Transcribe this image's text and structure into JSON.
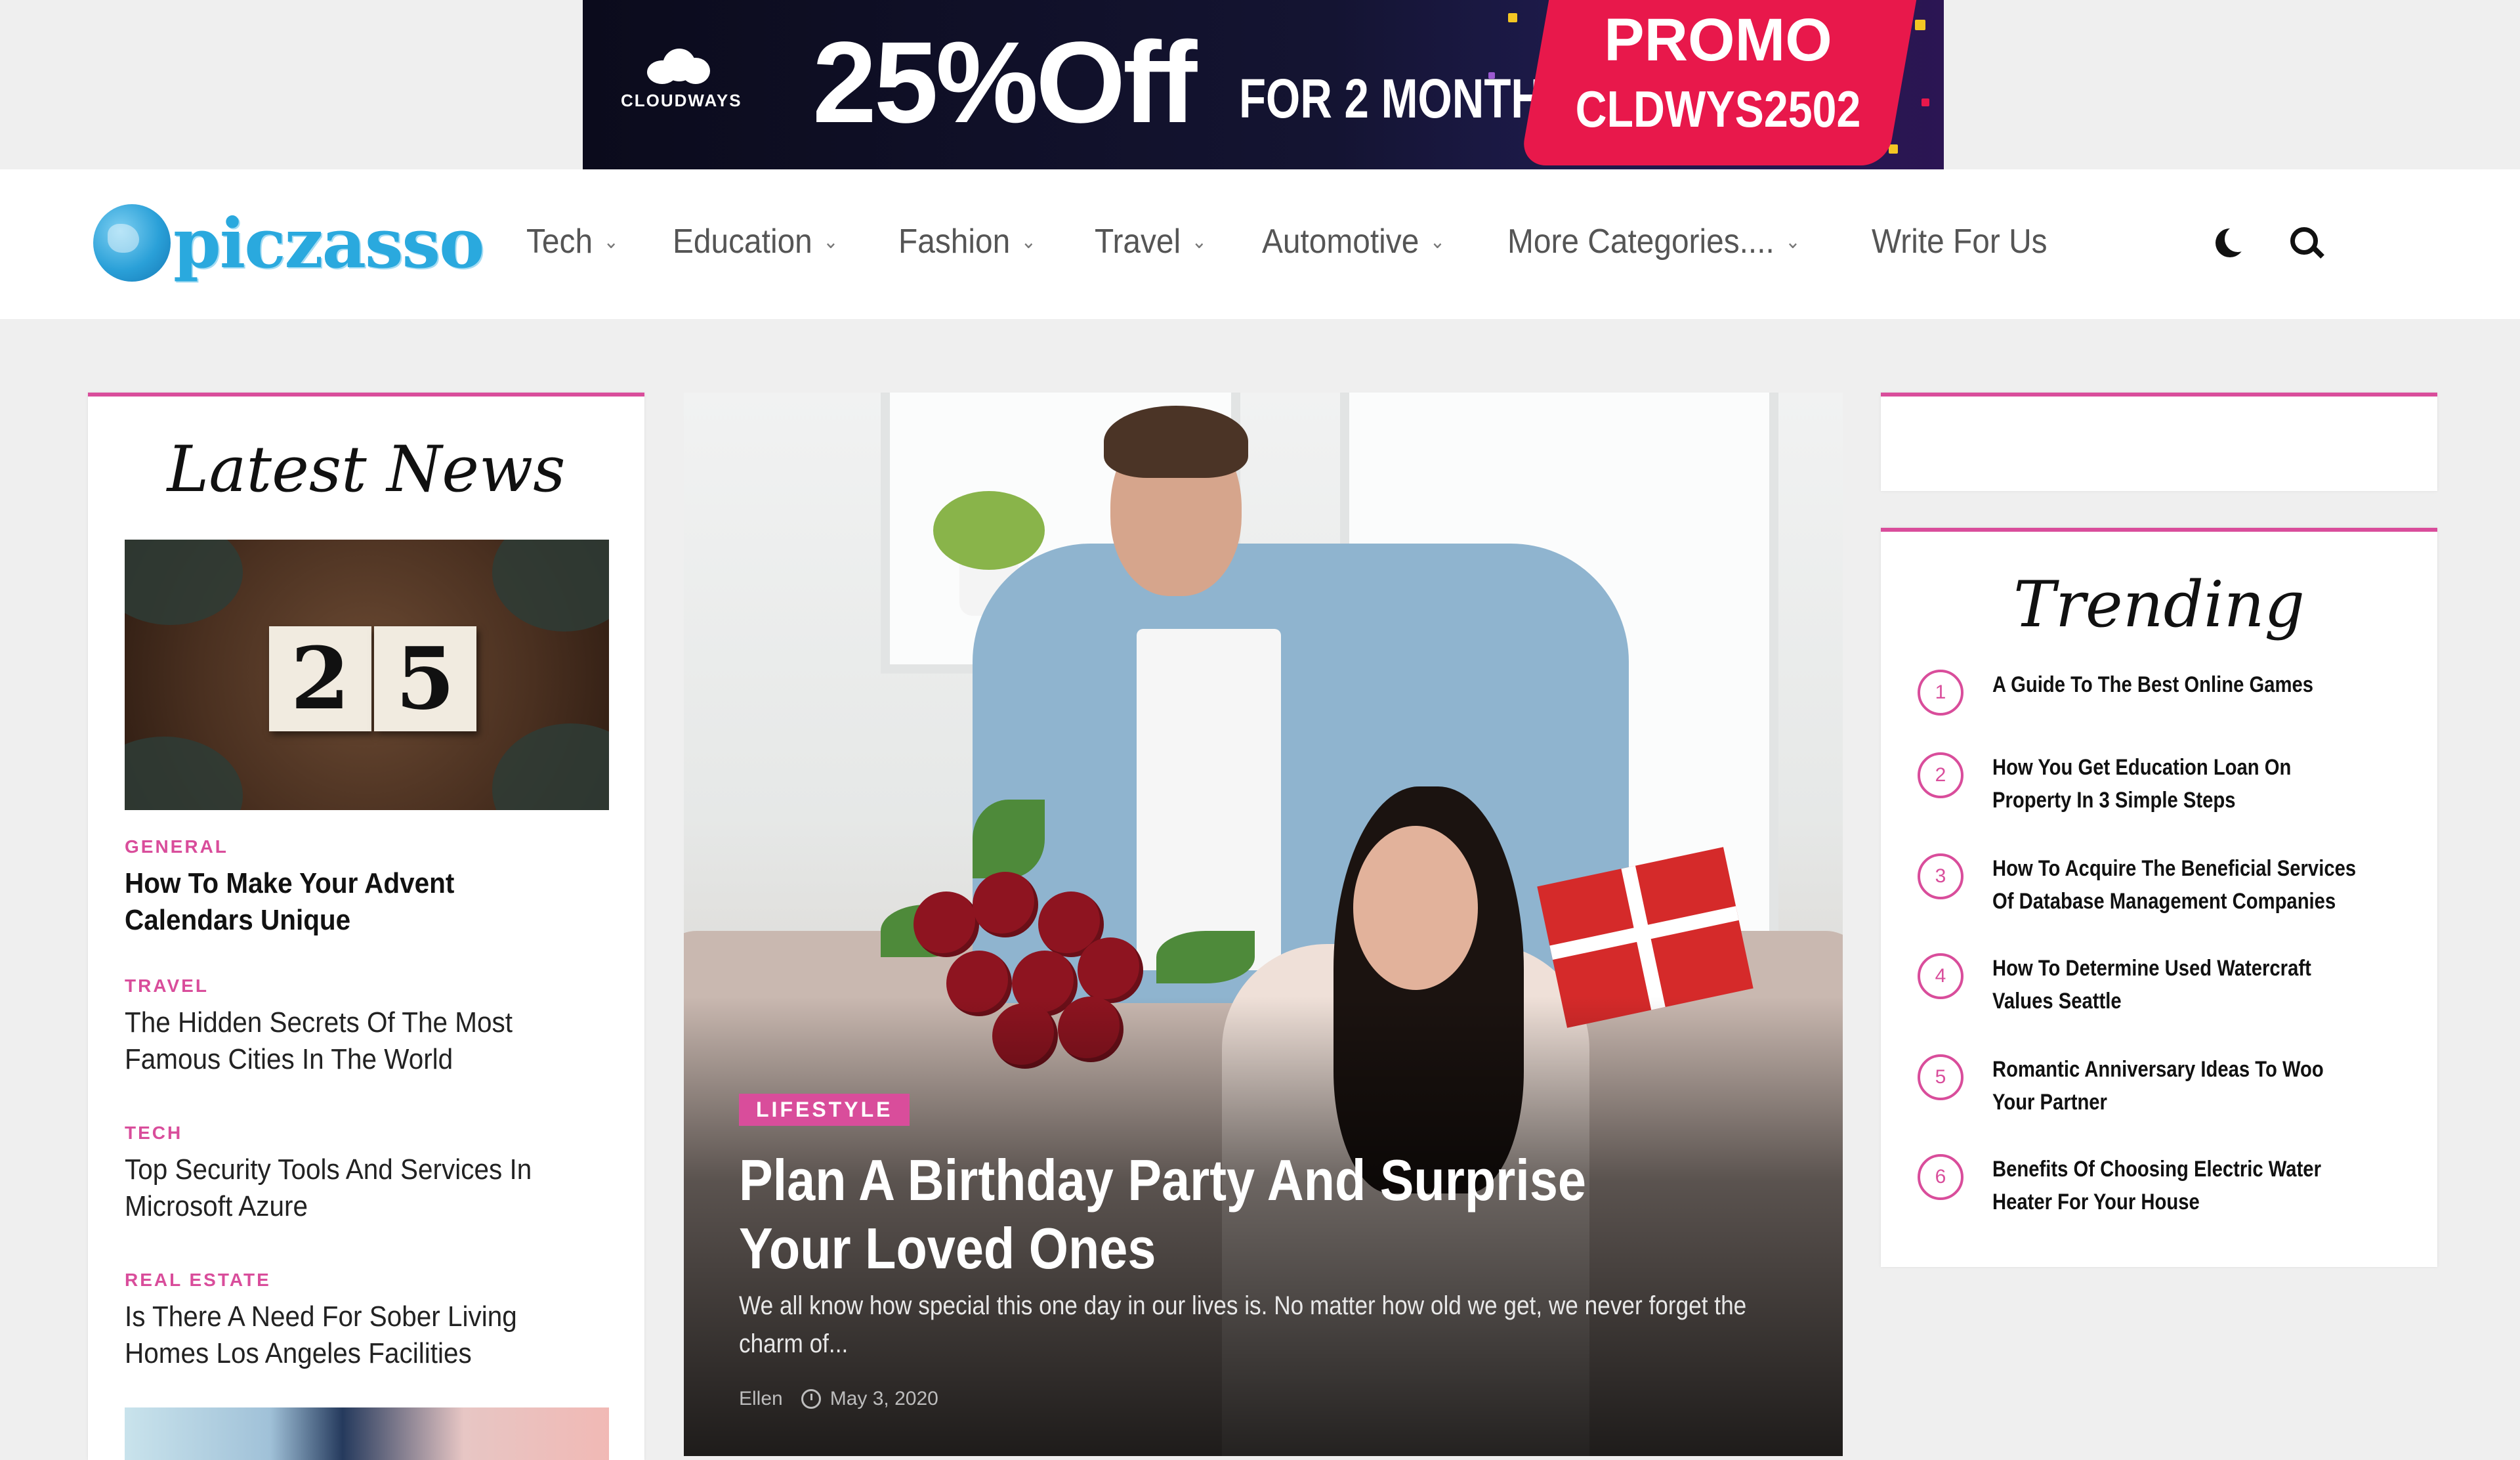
{
  "ad": {
    "brand": "CLOUDWAYS",
    "headline": "25%Off",
    "subline": "FOR 2 MONTHS",
    "promo_label": "PROMO",
    "promo_code": "CLDWYS2502"
  },
  "header": {
    "logo_text": "piczasso",
    "nav": [
      {
        "label": "Tech"
      },
      {
        "label": "Education"
      },
      {
        "label": "Fashion"
      },
      {
        "label": "Travel"
      },
      {
        "label": "Automotive"
      },
      {
        "label": "More Categories...."
      },
      {
        "label": "Write For Us"
      }
    ],
    "icons": [
      "moon-icon",
      "search-icon"
    ]
  },
  "latest": {
    "title": "Latest News",
    "thumb_digits": [
      "2",
      "5"
    ],
    "items": [
      {
        "category": "GENERAL",
        "title": "How To Make Your Advent Calendars Unique"
      },
      {
        "category": "TRAVEL",
        "title": "The Hidden Secrets Of The Most Famous Cities In The World"
      },
      {
        "category": "TECH",
        "title": "Top Security Tools And Services In Microsoft Azure"
      },
      {
        "category": "REAL ESTATE",
        "title": "Is There A Need For Sober Living Homes Los Angeles Facilities"
      }
    ]
  },
  "hero": {
    "tag": "LIFESTYLE",
    "title": "Plan A Birthday Party And Surprise Your Loved Ones",
    "excerpt": "We all know how special this one day in our lives is. No matter how old we get, we never forget the charm of...",
    "author": "Ellen",
    "date": "May 3, 2020"
  },
  "trending": {
    "title": "Trending",
    "items": [
      {
        "num": "1",
        "title": "A Guide To The Best Online Games"
      },
      {
        "num": "2",
        "title": "How You Get Education Loan On Property In 3 Simple Steps"
      },
      {
        "num": "3",
        "title": "How To Acquire The Beneficial Services Of Database Management Companies"
      },
      {
        "num": "4",
        "title": "How To Determine Used Watercraft Values Seattle"
      },
      {
        "num": "5",
        "title": "Romantic Anniversary Ideas To Woo Your Partner"
      },
      {
        "num": "6",
        "title": "Benefits Of Choosing Electric Water Heater For Your House"
      }
    ]
  },
  "colors": {
    "accent": "#d94d9b",
    "logo_blue": "#2aa9de",
    "promo_red": "#e8184b"
  }
}
